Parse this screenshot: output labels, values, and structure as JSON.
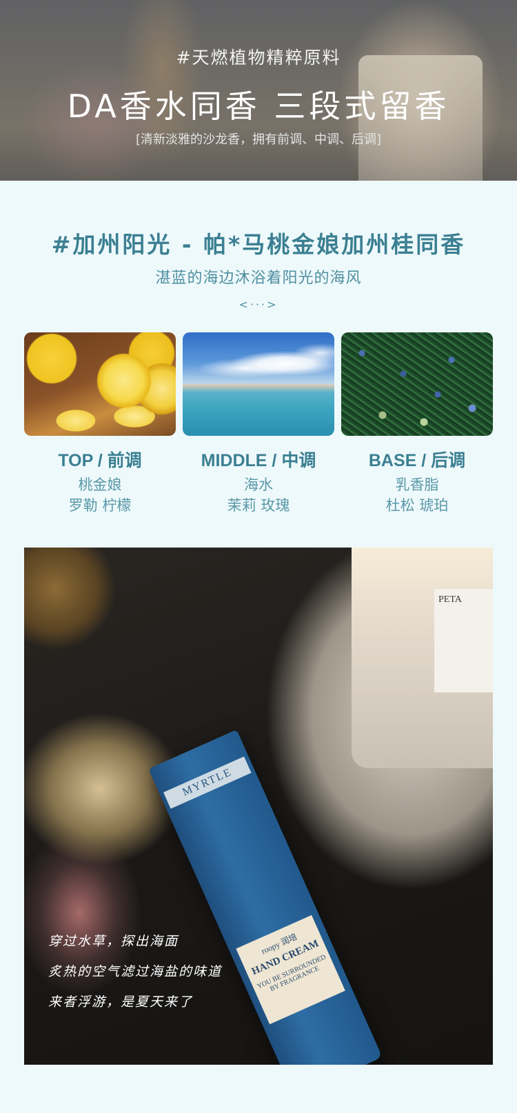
{
  "hero": {
    "tag": "#天燃植物精粹原料",
    "title": "DA香水同香 三段式留香",
    "subtitle": "[清新淡雅的沙龙香，拥有前调、中调、后调]"
  },
  "scent": {
    "title": "#加州阳光 - 帕*马桃金娘加州桂同香",
    "subtitle": "湛蓝的海边沐浴着阳光的海风",
    "pager": "<···>",
    "notes": [
      {
        "label": "TOP / 前调",
        "line1": "桃金娘",
        "line2": "罗勒 柠檬",
        "image": "lemon-image"
      },
      {
        "label": "MIDDLE / 中调",
        "line1": "海水",
        "line2": "茉莉 玫瑰",
        "image": "sea-image"
      },
      {
        "label": "BASE / 后调",
        "line1": "乳香脂",
        "line2": "杜松 琥珀",
        "image": "juniper-image"
      }
    ]
  },
  "photo": {
    "tube_band": "MYRTLE",
    "tube_brand": "roopy 润培",
    "tube_product": "HAND CREAM",
    "tube_tagline": "YOU BE SURROUNDED BY FRAGRANCE",
    "candle_label": "PETA",
    "poem": [
      "穿过水草，探出海面",
      "炙热的空气滤过海盐的味道",
      "来者浮游，是夏天来了"
    ]
  }
}
